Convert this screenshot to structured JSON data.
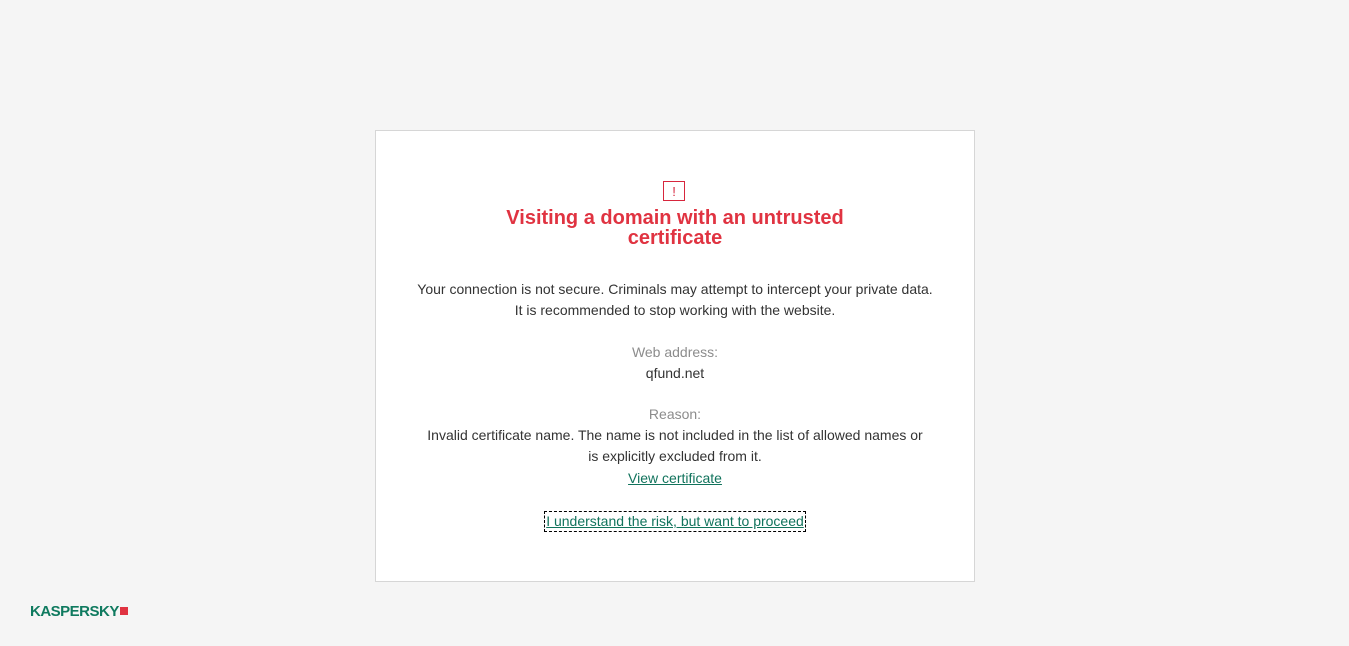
{
  "warning": {
    "icon_glyph": "!",
    "icon_name": "exclamation-warning-icon",
    "title": "Visiting a domain with an untrusted certificate",
    "description": "Your connection is not secure. Criminals may attempt to intercept your private data. It is recommended to stop working with the website."
  },
  "details": {
    "web_address_label": "Web address:",
    "web_address_value": "qfund.net",
    "reason_label": "Reason:",
    "reason_value": "Invalid certificate name. The name is not included in the list of allowed names or is explicitly excluded from it."
  },
  "actions": {
    "view_certificate": "View certificate",
    "proceed": "I understand the risk, but want to proceed"
  },
  "brand": {
    "logo_text": "KASPERSKY",
    "logo_icon_name": "kaspersky-lab-logo"
  },
  "colors": {
    "accent_red": "#e03341",
    "link_green": "#11735c",
    "background": "#f5f5f5"
  }
}
